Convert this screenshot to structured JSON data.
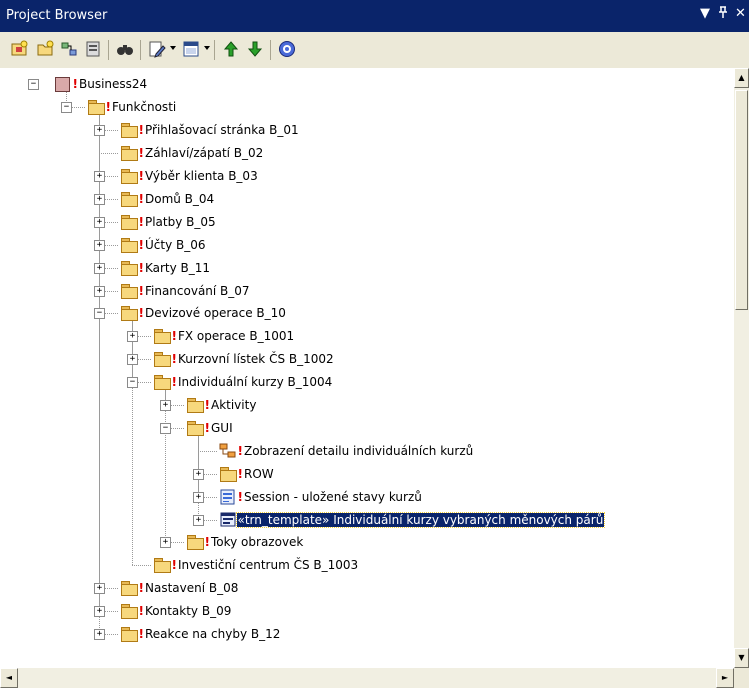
{
  "window": {
    "title": "Project Browser",
    "controls": {
      "menu": "▼",
      "pin": "ᵖ",
      "close": "✕"
    }
  },
  "toolbar": {
    "buttons": [
      {
        "name": "new-package-button",
        "icon": "package-new-icon"
      },
      {
        "name": "new-diagram-button",
        "icon": "diagram-new-icon"
      },
      {
        "name": "new-element-button",
        "icon": "element-new-icon"
      },
      {
        "name": "new-child-button",
        "icon": "child-new-icon"
      },
      {
        "name": "find-button",
        "icon": "binoculars-icon"
      },
      {
        "name": "properties-button",
        "icon": "edit-icon"
      },
      {
        "name": "view-button",
        "icon": "window-icon"
      },
      {
        "name": "move-up-button",
        "icon": "arrow-up-icon"
      },
      {
        "name": "move-down-button",
        "icon": "arrow-down-icon"
      },
      {
        "name": "help-button",
        "icon": "help-icon"
      }
    ]
  },
  "tree": {
    "colors": {
      "bang": "#e00000",
      "selection": "#0a246a"
    },
    "items": [
      {
        "label": "Business24",
        "level": 0,
        "icon": "db",
        "toggle": "−",
        "bang": "!"
      },
      {
        "label": "Funkčnosti",
        "level": 1,
        "icon": "folder",
        "toggle": "−",
        "bang": "!"
      },
      {
        "label": "Přihlašovací stránka B_01",
        "level": 2,
        "icon": "folder",
        "toggle": "+",
        "bang": "!"
      },
      {
        "label": "Záhlaví/zápatí B_02",
        "level": 2,
        "icon": "folder",
        "toggle": "",
        "bang": "!"
      },
      {
        "label": "Výběr klienta B_03",
        "level": 2,
        "icon": "folder",
        "toggle": "+",
        "bang": "!"
      },
      {
        "label": "Domů B_04",
        "level": 2,
        "icon": "folder",
        "toggle": "+",
        "bang": "!"
      },
      {
        "label": "Platby B_05",
        "level": 2,
        "icon": "folder",
        "toggle": "+",
        "bang": "!"
      },
      {
        "label": "Účty B_06",
        "level": 2,
        "icon": "folder",
        "toggle": "+",
        "bang": "!"
      },
      {
        "label": "Karty B_11",
        "level": 2,
        "icon": "folder",
        "toggle": "+",
        "bang": "!"
      },
      {
        "label": "Financování B_07",
        "level": 2,
        "icon": "folder",
        "toggle": "+",
        "bang": "!"
      },
      {
        "label": "Devizové operace B_10",
        "level": 2,
        "icon": "folder",
        "toggle": "−",
        "bang": "!"
      },
      {
        "label": "FX operace B_1001",
        "level": 3,
        "icon": "folder",
        "toggle": "+",
        "bang": "!"
      },
      {
        "label": "Kurzovní lístek ČS  B_1002",
        "level": 3,
        "icon": "folder",
        "toggle": "+",
        "bang": "!"
      },
      {
        "label": "Individuální kurzy B_1004",
        "level": 3,
        "icon": "folder",
        "toggle": "−",
        "bang": "!"
      },
      {
        "label": "Aktivity",
        "level": 4,
        "icon": "folder",
        "toggle": "+",
        "bang": "!"
      },
      {
        "label": "GUI",
        "level": 4,
        "icon": "folder",
        "toggle": "−",
        "bang": "!"
      },
      {
        "label": "Zobrazení detailu individuálních kurzů",
        "level": 5,
        "icon": "diagram",
        "toggle": "",
        "bang": "!"
      },
      {
        "label": "ROW",
        "level": 5,
        "icon": "folder",
        "toggle": "+",
        "bang": "!"
      },
      {
        "label": "Session - uložené stavy kurzů",
        "level": 5,
        "icon": "doc",
        "toggle": "+",
        "bang": "!"
      },
      {
        "label": "«trn_template» Individuální kurzy vybraných měnových párů",
        "level": 5,
        "icon": "template",
        "toggle": "+",
        "bang": "",
        "selected": true
      },
      {
        "label": "Toky obrazovek",
        "level": 4,
        "icon": "folder",
        "toggle": "+",
        "bang": "!"
      },
      {
        "label": "Investiční centrum ČS B_1003",
        "level": 3,
        "icon": "folder",
        "toggle": "",
        "bang": "!"
      },
      {
        "label": "Nastavení B_08",
        "level": 2,
        "icon": "folder",
        "toggle": "+",
        "bang": "!"
      },
      {
        "label": "Kontakty B_09",
        "level": 2,
        "icon": "folder",
        "toggle": "+",
        "bang": "!"
      },
      {
        "label": "Reakce na chyby B_12",
        "level": 2,
        "icon": "folder",
        "toggle": "+",
        "bang": "!"
      }
    ]
  },
  "scrollbars": {
    "up": "▲",
    "down": "▼",
    "left": "◄",
    "right": "►"
  }
}
